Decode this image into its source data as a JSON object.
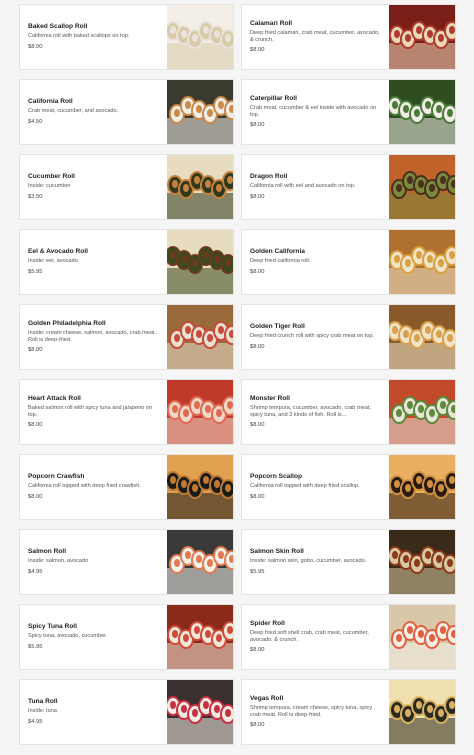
{
  "menu": {
    "items": [
      {
        "name": "Baked Scallop Roll",
        "desc": "California roll with baked scallops on top.",
        "price": "$8.00",
        "img": "baked-scallop-roll-photo"
      },
      {
        "name": "Calamari Roll",
        "desc": "Deep fried calamari, crab meat, cucumber, avocado, & crunch.",
        "price": "$8.00",
        "img": "calamari-roll-photo"
      },
      {
        "name": "California Roll",
        "desc": "Crab meat, cucumber, and avocado.",
        "price": "$4.50",
        "img": "california-roll-photo"
      },
      {
        "name": "Caterpillar Roll",
        "desc": "Crab meat, cucumber & eel inside with avocado on top.",
        "price": "$8.00",
        "img": "caterpillar-roll-photo"
      },
      {
        "name": "Cucumber Roll",
        "desc": "Inside: cucumber",
        "price": "$3.50",
        "img": "cucumber-roll-photo"
      },
      {
        "name": "Dragon Roll",
        "desc": "California roll with eel and avocado on top.",
        "price": "$8.00",
        "img": "dragon-roll-photo"
      },
      {
        "name": "Eel & Avocado Roll",
        "desc": "Inside: eel, avocado",
        "price": "$5.95",
        "img": "eel-avocado-roll-photo"
      },
      {
        "name": "Golden California",
        "desc": "Deep fried california roll.",
        "price": "$8.00",
        "img": "golden-california-photo"
      },
      {
        "name": "Golden Philadelphia Roll",
        "desc": "Inside: cream cheese, salmon, avocado, crab meat. Roll is deep-fried.",
        "price": "$8.00",
        "img": "golden-philadelphia-roll-photo"
      },
      {
        "name": "Golden Tiger Roll",
        "desc": "Deep fried crunch roll with spicy crab meat on top.",
        "price": "$8.00",
        "img": "golden-tiger-roll-photo"
      },
      {
        "name": "Heart Attack Roll",
        "desc": "Baked salmon roll with spicy tuna and jalapeno on top.",
        "price": "$8.00",
        "img": "heart-attack-roll-photo"
      },
      {
        "name": "Monster Roll",
        "desc": "Shrimp tempura, cucumber, avocado, crab meat, spicy tuna, and 3 kinds of fish. Roll is...",
        "price": "$8.00",
        "img": "monster-roll-photo"
      },
      {
        "name": "Popcorn Crawfish",
        "desc": "California roll topped with deep fried crawfish.",
        "price": "$8.00",
        "img": "popcorn-crawfish-photo"
      },
      {
        "name": "Popcorn Scallop",
        "desc": "California roll topped with deep fried scallop.",
        "price": "$8.00",
        "img": "popcorn-scallop-photo"
      },
      {
        "name": "Salmon Roll",
        "desc": "Inside: salmon, avocado",
        "price": "$4.95",
        "img": "salmon-roll-photo"
      },
      {
        "name": "Salmon Skin Roll",
        "desc": "Inside: salmon skin, gobo, cucumber, avocado.",
        "price": "$5.95",
        "img": "salmon-skin-roll-photo"
      },
      {
        "name": "Spicy Tuna Roll",
        "desc": "Spicy tuna, avocado, cucumber.",
        "price": "$5.95",
        "img": "spicy-tuna-roll-photo"
      },
      {
        "name": "Spider Roll",
        "desc": "Deep fried soft shell crab, crab meat, cucumber, avocado, & crunch.",
        "price": "$8.00",
        "img": "spider-roll-photo"
      },
      {
        "name": "Tuna Roll",
        "desc": "Inside: tuna",
        "price": "$4.95",
        "img": "tuna-roll-photo"
      },
      {
        "name": "Vegas Roll",
        "desc": "Shrimp tempura, cream cheese, spicy tuna, spicy crab meat. Roll is deep-fried.",
        "price": "$8.00",
        "img": "vegas-roll-photo"
      }
    ]
  },
  "colors": {
    "background": "#f5f5f5",
    "card": "#ffffff",
    "border": "#e3e3e3",
    "title": "#1f1f1f",
    "text": "#555555"
  }
}
